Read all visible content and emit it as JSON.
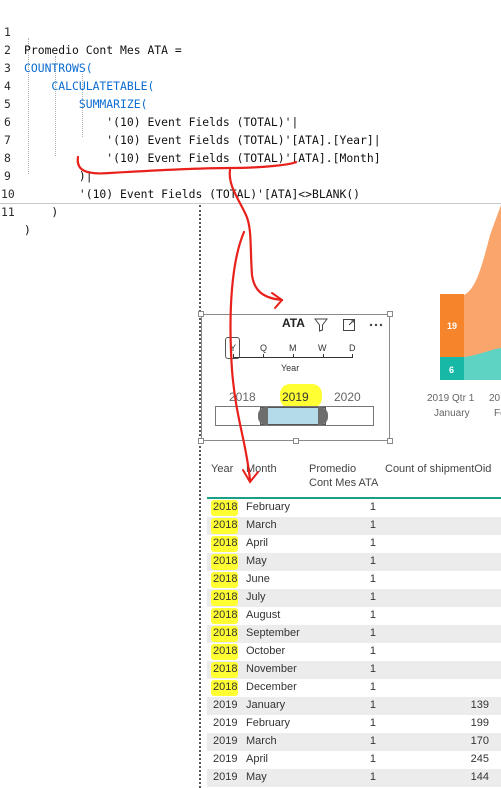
{
  "editor": {
    "lines": [
      {
        "num": "1",
        "text": "Promedio Cont Mes ATA ="
      },
      {
        "num": "2",
        "text": "COUNTROWS("
      },
      {
        "num": "3",
        "text": "    CALCULATETABLE("
      },
      {
        "num": "4",
        "text": "        SUMMARIZE("
      },
      {
        "num": "5",
        "text": "            '(10) Event Fields (TOTAL)'|"
      },
      {
        "num": "6",
        "text": "            '(10) Event Fields (TOTAL)'[ATA].[Year]|"
      },
      {
        "num": "7",
        "text": "            '(10) Event Fields (TOTAL)'[ATA].[Month]"
      },
      {
        "num": "8",
        "text": "        )|"
      },
      {
        "num": "9",
        "text": "        '(10) Event Fields (TOTAL)'[ATA]<>BLANK()"
      },
      {
        "num": "10",
        "text": "    )"
      },
      {
        "num": "11",
        "text": ")"
      }
    ]
  },
  "slicer": {
    "title": "ATA",
    "granularity": [
      "Y",
      "Q",
      "M",
      "W",
      "D"
    ],
    "granularity_label": "Year",
    "years": [
      "2018",
      "2019",
      "2020"
    ],
    "selected_year": "2019",
    "icons": [
      "filter-icon",
      "focus-mode-icon",
      "more-options-icon"
    ]
  },
  "chart": {
    "values": [
      "19",
      "6"
    ],
    "axis_label_1": "2019 Qtr 1",
    "axis_label_2": "January",
    "axis_label_3": "20",
    "axis_label_4": "Fe",
    "colors": {
      "orange": "#f5842b",
      "teal": "#17b8a5",
      "orange_area": "#f9a56b",
      "teal_area": "#5fd3c3"
    }
  },
  "table": {
    "headers": {
      "year": "Year",
      "month": "Month",
      "promedio_1": "Promedio",
      "promedio_2": "Cont Mes ATA",
      "count": "Count of shipmentOid"
    },
    "rows": [
      {
        "year": "2018",
        "month": "February",
        "promedio": "1",
        "count": ""
      },
      {
        "year": "2018",
        "month": "March",
        "promedio": "1",
        "count": ""
      },
      {
        "year": "2018",
        "month": "April",
        "promedio": "1",
        "count": ""
      },
      {
        "year": "2018",
        "month": "May",
        "promedio": "1",
        "count": ""
      },
      {
        "year": "2018",
        "month": "June",
        "promedio": "1",
        "count": ""
      },
      {
        "year": "2018",
        "month": "July",
        "promedio": "1",
        "count": ""
      },
      {
        "year": "2018",
        "month": "August",
        "promedio": "1",
        "count": ""
      },
      {
        "year": "2018",
        "month": "September",
        "promedio": "1",
        "count": ""
      },
      {
        "year": "2018",
        "month": "October",
        "promedio": "1",
        "count": ""
      },
      {
        "year": "2018",
        "month": "November",
        "promedio": "1",
        "count": ""
      },
      {
        "year": "2018",
        "month": "December",
        "promedio": "1",
        "count": ""
      },
      {
        "year": "2019",
        "month": "January",
        "promedio": "1",
        "count": "139"
      },
      {
        "year": "2019",
        "month": "February",
        "promedio": "1",
        "count": "199"
      },
      {
        "year": "2019",
        "month": "March",
        "promedio": "1",
        "count": "170"
      },
      {
        "year": "2019",
        "month": "April",
        "promedio": "1",
        "count": "245"
      },
      {
        "year": "2019",
        "month": "May",
        "promedio": "1",
        "count": "144"
      }
    ]
  },
  "colors": {
    "highlight": "#ffff33",
    "annotation": "#e8211c",
    "header_rule": "#1aa086",
    "code_keyword": "#0b6cd1"
  }
}
